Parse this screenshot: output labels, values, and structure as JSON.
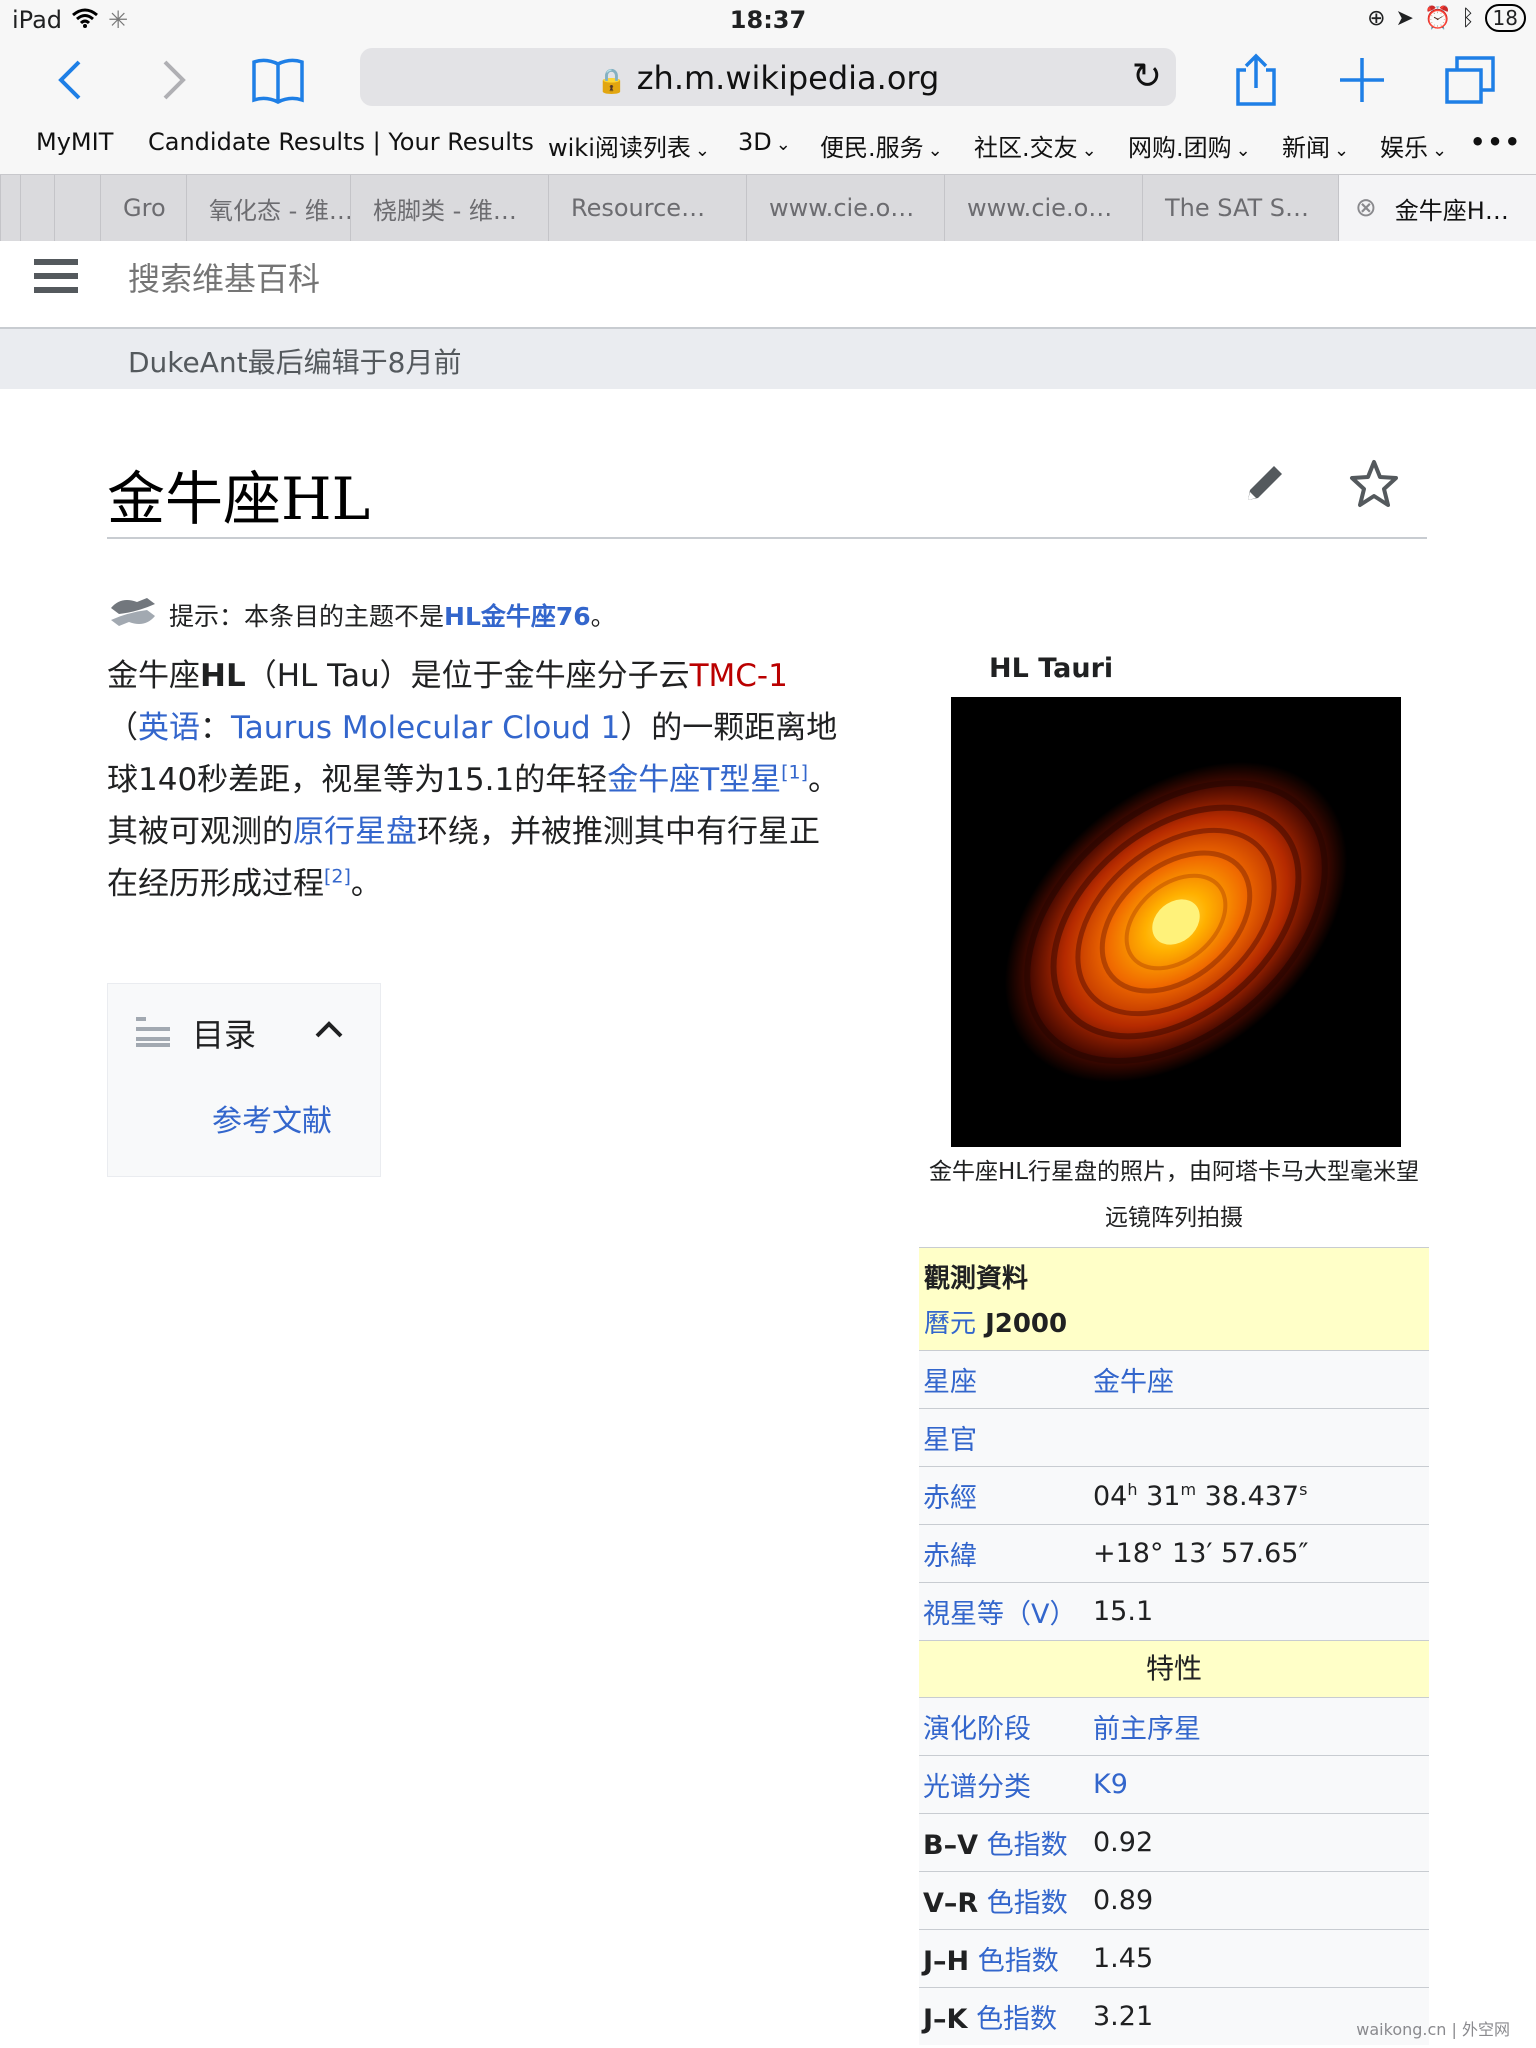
{
  "statusbar": {
    "device": "iPad",
    "time": "18:37",
    "battery": "18"
  },
  "toolbar": {
    "url": "zh.m.wikipedia.org"
  },
  "bookmarks": [
    {
      "label": "MyMIT",
      "menu": false
    },
    {
      "label": "Candidate Results | Your Results",
      "menu": false
    },
    {
      "label": "wiki阅读列表",
      "menu": true
    },
    {
      "label": "3D",
      "menu": true
    },
    {
      "label": "便民.服务",
      "menu": true
    },
    {
      "label": "社区.交友",
      "menu": true
    },
    {
      "label": "网购.团购",
      "menu": true
    },
    {
      "label": "新闻",
      "menu": true
    },
    {
      "label": "娱乐",
      "menu": true
    }
  ],
  "tabs": [
    "Gro",
    "氧化态 - 维…",
    "桡脚类 - 维…",
    "Resource…",
    "www.cie.o…",
    "www.cie.o…",
    "The SAT S…",
    "金牛座H…"
  ],
  "wiki": {
    "search_placeholder": "搜索维基百科",
    "last_edit": "DukeAnt最后编辑于8月前",
    "title": "金牛座HL",
    "hatnote_prefix": "提示：本条目的主题不是",
    "hatnote_link": "HL金牛座76",
    "hatnote_suffix": "。",
    "lead": {
      "t1": "金牛座",
      "t2": "HL",
      "t3": "（HL Tau）是位于金牛座分子云",
      "t4": "TMC-1",
      "t5": "（",
      "t6": "英语",
      "t7": "：",
      "t8": "Taurus Molecular Cloud 1",
      "t9": "）的一颗距离地球140秒差距，视星等为15.1的年轻",
      "t10": "金牛座T型星",
      "t11": "[1]",
      "t12": "。其被可观测的",
      "t13": "原行星盘",
      "t14": "环绕，并被推测其中有行星正在经历形成过程",
      "t15": "[2]",
      "t16": "。"
    },
    "toc": {
      "title": "目录",
      "items": [
        "参考文献"
      ]
    }
  },
  "infobox": {
    "title": "HL Tauri",
    "caption": "金牛座HL行星盘的照片，由阿塔卡马大型毫米望远镜阵列拍摄",
    "obs_header": "觀測資料",
    "epoch_label": "曆元",
    "epoch_value": " J2000",
    "rows": [
      {
        "label": "星座",
        "value": "金牛座"
      },
      {
        "label": "星官",
        "value": ""
      },
      {
        "label": "赤經",
        "value_h": "04",
        "value_m": "31",
        "value_s": "38.437"
      },
      {
        "label": "赤緯",
        "value": "+18° 13′ 57.65″"
      },
      {
        "label": "視星等（V）",
        "value": "15.1"
      }
    ],
    "section": "特性",
    "rows2": [
      {
        "label": "演化阶段",
        "value": "前主序星"
      },
      {
        "label": "光谱分类",
        "value": "K9"
      },
      {
        "label_bold": "B–V",
        "label_link": "色指数",
        "value": "0.92"
      },
      {
        "label_bold": "V–R",
        "label_link": "色指数",
        "value": "0.89"
      },
      {
        "label_bold": "J–H",
        "label_link": "色指数",
        "value": "1.45"
      },
      {
        "label_bold": "J–K",
        "label_link": "色指数",
        "value": "3.21"
      }
    ]
  },
  "watermark": "waikong.cn | 外空网"
}
